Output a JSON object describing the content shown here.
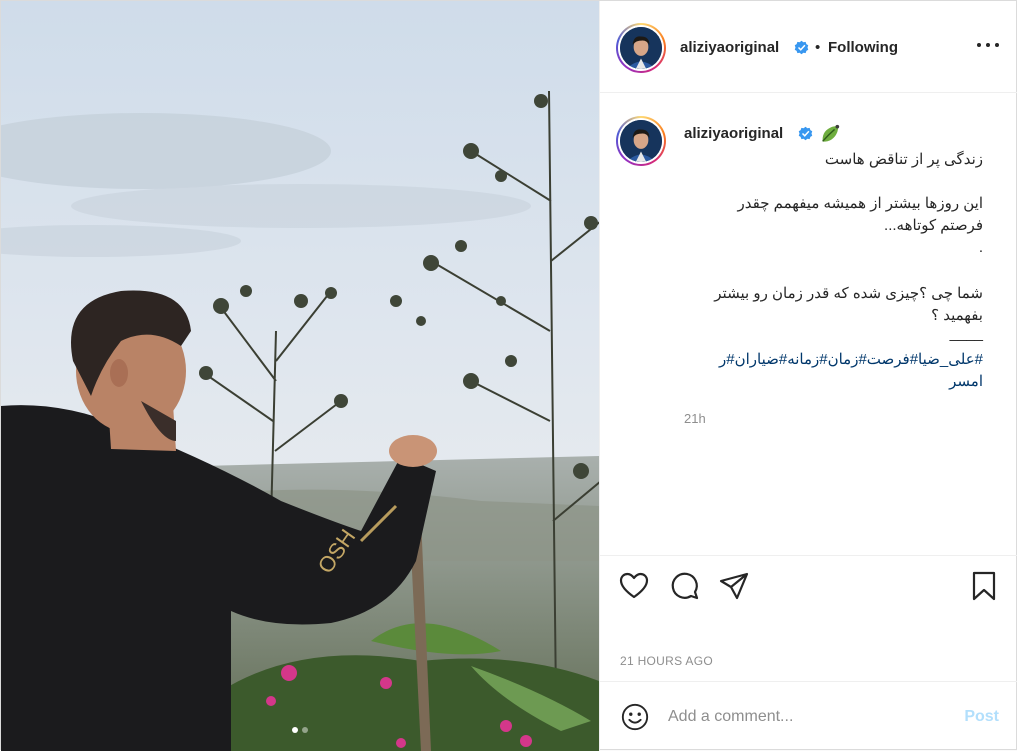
{
  "post": {
    "username": "aliziyaoriginal",
    "verified": true,
    "separator": "•",
    "follow_status": "Following",
    "more_icon": "more-options-icon"
  },
  "caption": {
    "username": "aliziyaoriginal",
    "emoji_icon": "leaf-emoji-icon",
    "lines": [
      "زندگی پر از تناقض هاست",
      "این روزها بیشتر از همیشه میفهمم چقدر",
      "فرصتم کوتاهه...",
      ".",
      "شما چی ؟چیزی شده که قدر زمان رو بیشتر",
      "بفهمید ؟",
      "____"
    ],
    "hashtags_line1": "#علی_ضیا#فرصت#زمان#زمانه#ضیاران#ر",
    "hashtags_line2": "امسر",
    "time_ago": "21h"
  },
  "actions": {
    "like_icon": "heart-icon",
    "comment_icon": "comment-icon",
    "share_icon": "share-icon",
    "save_icon": "bookmark-icon",
    "posted": "21 HOURS AGO"
  },
  "comment_box": {
    "emoji_icon": "emoji-icon",
    "placeholder": "Add a comment...",
    "post_label": "Post"
  },
  "colors": {
    "link": "#00376b",
    "verified": "#3897f0",
    "post_disabled": "#b2dffc"
  }
}
